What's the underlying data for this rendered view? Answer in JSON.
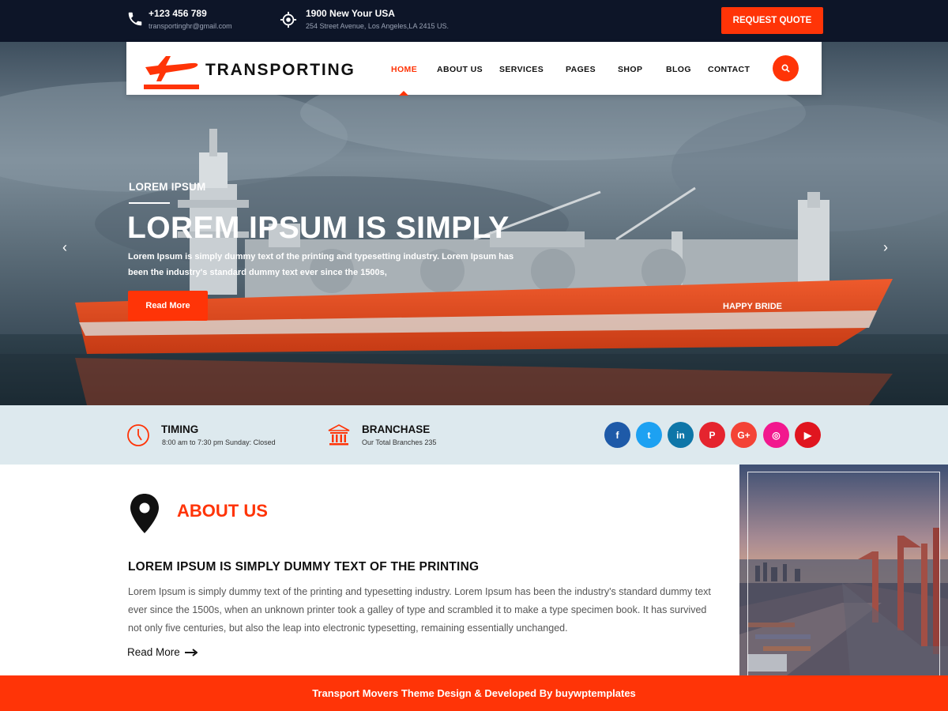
{
  "topbar": {
    "phone": "+123 456 789",
    "email": "transportinghr@gmail.com",
    "address_title": "1900 New Your USA",
    "address_line": "254 Street Avenue, Los Angeles,LA 2415 US.",
    "quote_button": "REQUEST QUOTE",
    "icons": {
      "phone": "phone-icon",
      "location": "location-target-icon"
    }
  },
  "nav": {
    "logo_text": "TRANSPORTING",
    "logo_icon": "airplane-logo-icon",
    "items": [
      {
        "label": "HOME",
        "active": true
      },
      {
        "label": "ABOUT US",
        "active": false
      },
      {
        "label": "SERVICES",
        "active": false
      },
      {
        "label": "PAGES",
        "active": false
      },
      {
        "label": "SHOP",
        "active": false
      },
      {
        "label": "BLOG",
        "active": false
      },
      {
        "label": "CONTACT",
        "active": false
      }
    ],
    "search_icon": "search-icon"
  },
  "hero": {
    "eyebrow": "LOREM IPSUM",
    "title": "LOREM IPSUM IS SIMPLY",
    "description": "Lorem Ipsum is simply dummy text of the printing and typesetting industry. Lorem Ipsum has been the industry's standard dummy text ever since the 1500s,",
    "button": "Read More",
    "prev_icon": "chevron-left-icon",
    "next_icon": "chevron-right-icon",
    "ship_name": "HAPPY BRIDE"
  },
  "info": {
    "timing_title": "TIMING",
    "timing_text": "8:00 am to 7:30 pm  Sunday: Closed",
    "branch_title": "BRANCHASE",
    "branch_text": "Our Total Branches 235",
    "socials": [
      {
        "name": "facebook-icon",
        "glyph": "f",
        "color": "#1e5aa8"
      },
      {
        "name": "twitter-icon",
        "glyph": "t",
        "color": "#1da1f2"
      },
      {
        "name": "linkedin-icon",
        "glyph": "in",
        "color": "#0e76a8"
      },
      {
        "name": "pinterest-icon",
        "glyph": "P",
        "color": "#e5242e"
      },
      {
        "name": "google-plus-icon",
        "glyph": "G+",
        "color": "#f44336"
      },
      {
        "name": "instagram-icon",
        "glyph": "◎",
        "color": "#f2188e"
      },
      {
        "name": "youtube-icon",
        "glyph": "▶",
        "color": "#e0151f"
      }
    ]
  },
  "about": {
    "heading": "ABOUT US",
    "subheading": "LOREM IPSUM IS SIMPLY DUMMY TEXT OF THE PRINTING",
    "text": "Lorem Ipsum is simply dummy text of the printing and typesetting industry. Lorem Ipsum has been the industry's standard dummy text ever since the 1500s, when an unknown printer took a galley of type and scrambled it to make a type specimen book. It has survived not only five centuries, but also the leap into electronic typesetting, remaining essentially unchanged.",
    "read_more": "Read More",
    "icon": "map-pin-icon"
  },
  "footer": {
    "text": "Transport Movers Theme Design & Developed By buywptemplates"
  },
  "colors": {
    "accent": "#ff3407",
    "topbar": "#0d1528",
    "info_strip": "#dde9ee"
  }
}
